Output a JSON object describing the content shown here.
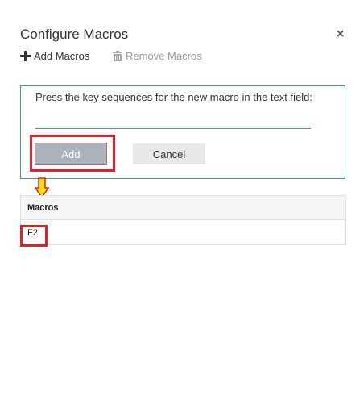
{
  "dialog": {
    "title": "Configure Macros",
    "close_glyph": "×"
  },
  "toolbar": {
    "add_label": "Add Macros",
    "add_icon": "plus-icon",
    "remove_label": "Remove Macros",
    "remove_icon": "trash-icon",
    "remove_enabled": false
  },
  "form": {
    "instruction": "Press the key sequences for the new macro in the text field:",
    "input_value": "",
    "add_label": "Add",
    "cancel_label": "Cancel"
  },
  "table": {
    "columns": [
      "Macros"
    ],
    "rows": [
      {
        "macro": "F2"
      }
    ]
  },
  "annotations": {
    "highlight_color": "#e0202a",
    "arrow_color": "#f5e10a"
  },
  "colors": {
    "accent": "#4a9a9a",
    "add_button_bg": "#aab3bc",
    "cancel_button_bg": "#e6e8ea"
  }
}
